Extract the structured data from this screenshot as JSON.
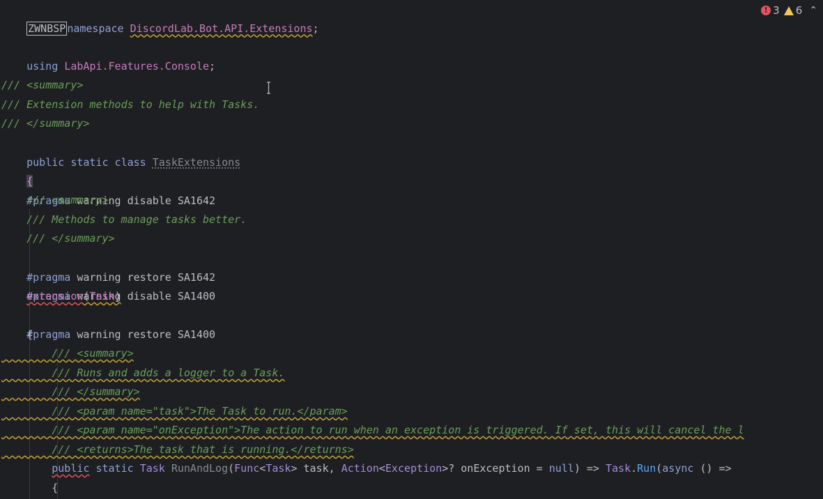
{
  "status": {
    "error_count": "3",
    "warning_count": "6"
  },
  "code": {
    "l1_zw": "ZWNBSP",
    "l1_kw": "namespace",
    "l1_ns": "DiscordLab.Bot.API.Extensions",
    "l1_end": ";",
    "l3_kw": "using",
    "l3_ns": "LabApi.Features.Console",
    "l3_end": ";",
    "l5": "/// <summary>",
    "l6": "/// Extension methods to help with Tasks.",
    "l7": "/// </summary>",
    "l8_kw": "public static class",
    "l8_cls": "TaskExtensions",
    "l9": "{",
    "l10_kw": "#pragma",
    "l10_rest": " warning disable SA1642",
    "l11": "    /// <summary>",
    "l12": "    /// Methods to manage tasks better.",
    "l13": "    /// </summary>",
    "l14_kw": "#pragma",
    "l14_rest": " warning restore SA1642",
    "l15_kw": "#pragma",
    "l15_rest": " warning disable SA1400",
    "l16_ext": "extension",
    "l16_paren_open": "(",
    "l16_type": "Task",
    "l16_paren_close": ")",
    "l17_kw": "#pragma",
    "l17_rest": " warning restore SA1400",
    "l18": "    {",
    "l19": "/// <summary>",
    "l20": "/// Runs and adds a logger to a Task.",
    "l21": "/// </summary>",
    "l22": "/// <param name=\"task\">The Task to run.</param>",
    "l23": "/// <param name=\"onException\">The action to run when an exception is triggered. If set, this will cancel the l",
    "l24": "/// <returns>The task that is running.</returns>",
    "l25_public": "public",
    "l25_static": " static ",
    "l25_task": "Task",
    "l25_method": " RunAndLog",
    "l25_p1": "(",
    "l25_func": "Func",
    "l25_lt1": "<",
    "l25_task2": "Task",
    "l25_gt1": "> task, ",
    "l25_action": "Action",
    "l25_lt2": "<",
    "l25_exc": "Exception",
    "l25_rest1": ">? onException = ",
    "l25_null": "null",
    "l25_rest2": ") => ",
    "l25_task3": "Task",
    "l25_dot": ".",
    "l25_run": "Run",
    "l25_p2": "(",
    "l25_async": "async",
    "l25_rest3": " () =>",
    "l26": "{"
  }
}
